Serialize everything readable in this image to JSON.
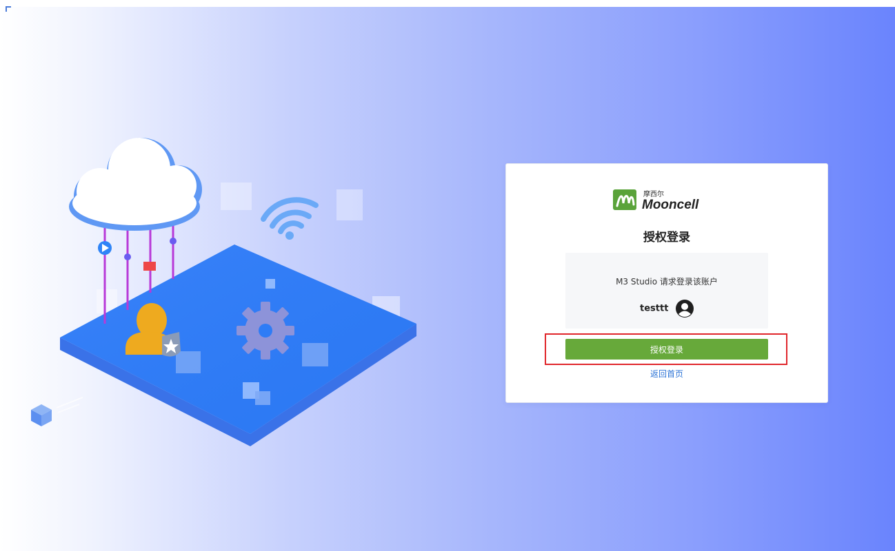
{
  "brand": {
    "chinese_name": "摩西尔",
    "name": "Mooncell",
    "accent_color": "#5aa33a"
  },
  "page_title": "授权登录",
  "request_text": "M3 Studio 请求登录该账户",
  "user": {
    "username": "testtt",
    "avatar_icon": "user-circle-icon"
  },
  "authorize_button_label": "授权登录",
  "back_link_label": "返回首页",
  "colors": {
    "button": "#67a93a",
    "link": "#2b73d6",
    "highlight_border": "#e0252a",
    "background_end": "#6a84fd"
  }
}
